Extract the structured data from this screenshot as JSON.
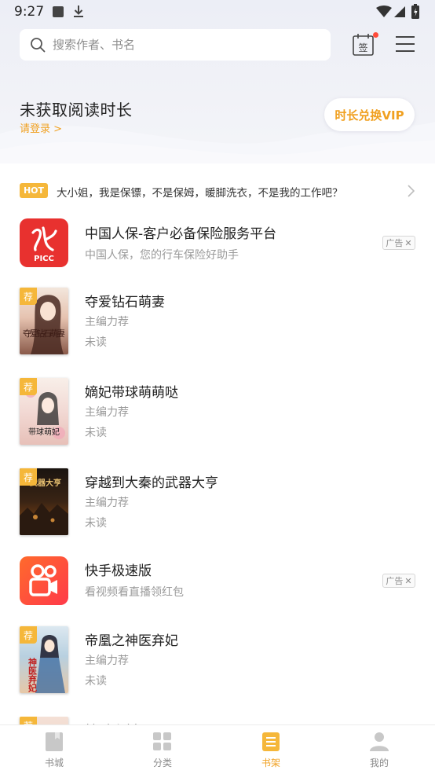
{
  "status_bar": {
    "time": "9:27"
  },
  "search": {
    "placeholder": "搜索作者、书名"
  },
  "header": {
    "sign_label": "签",
    "reading_title": "未获取阅读时长",
    "login_link": "请登录 >",
    "vip_button": "时长兑换VIP"
  },
  "hot": {
    "badge": "HOT",
    "text": "大小姐，我是保镖，不是保姆，暖脚洗衣，不是我的工作吧？"
  },
  "items": [
    {
      "type": "ad",
      "title": "中国人保-客户必备保险服务平台",
      "sub1": "中国人保，您的行车保险好助手",
      "ad_label": "广告",
      "icon_text": "PICC"
    },
    {
      "type": "book",
      "tag": "荐",
      "title": "夺爱钻石萌妻",
      "sub1": "主编力荐",
      "sub2": "未读",
      "cover_text": "夺爱钻石萌妻"
    },
    {
      "type": "book",
      "tag": "荐",
      "title": "嫡妃带球萌萌哒",
      "sub1": "主编力荐",
      "sub2": "未读",
      "cover_text": "带球萌妃"
    },
    {
      "type": "book",
      "tag": "荐",
      "title": "穿越到大秦的武器大亨",
      "sub1": "主编力荐",
      "sub2": "未读",
      "cover_text": "武器大亨"
    },
    {
      "type": "ad",
      "title": "快手极速版",
      "sub1": "看视频看直播领红包",
      "ad_label": "广告"
    },
    {
      "type": "book",
      "tag": "荐",
      "title": "帝凰之神医弃妃",
      "sub1": "主编力荐",
      "sub2": "未读",
      "cover_text": "神医弃妃"
    },
    {
      "type": "book",
      "tag": "荐",
      "title": "妙手小村医",
      "sub1": "",
      "sub2": ""
    }
  ],
  "tabs": [
    {
      "label": "书城",
      "icon": "book-city-icon",
      "active": false
    },
    {
      "label": "分类",
      "icon": "category-icon",
      "active": false
    },
    {
      "label": "书架",
      "icon": "bookshelf-icon",
      "active": true
    },
    {
      "label": "我的",
      "icon": "profile-icon",
      "active": false
    }
  ],
  "colors": {
    "accent": "#f0a020",
    "hot_badge": "#f5b73a",
    "picc_red": "#e8312f",
    "kuaishou": "#ff5a2c"
  }
}
